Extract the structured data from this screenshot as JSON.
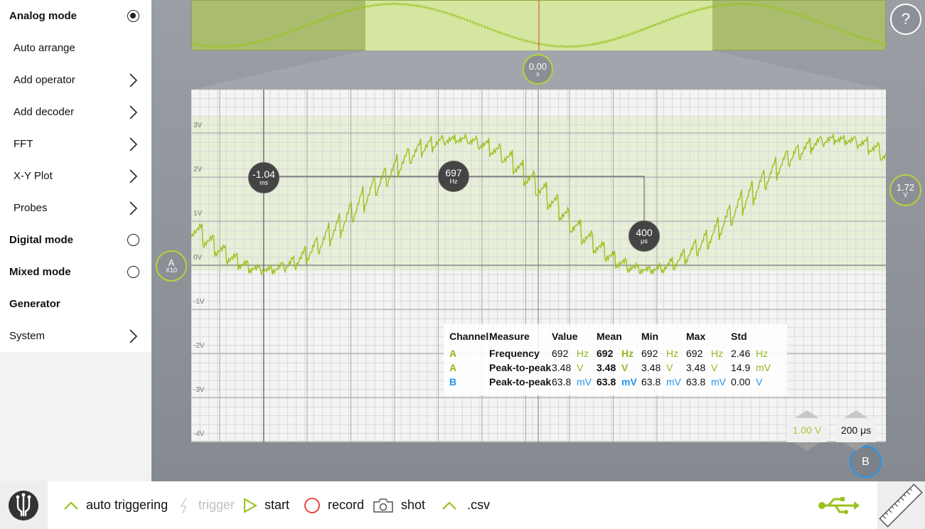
{
  "sidebar": {
    "items": [
      {
        "label": "Analog mode",
        "kind": "radio",
        "selected": true
      },
      {
        "label": "Auto arrange",
        "kind": "action"
      },
      {
        "label": "Add operator",
        "kind": "submenu"
      },
      {
        "label": "Add decoder",
        "kind": "submenu"
      },
      {
        "label": "FFT",
        "kind": "submenu"
      },
      {
        "label": "X-Y Plot",
        "kind": "submenu"
      },
      {
        "label": "Probes",
        "kind": "submenu"
      },
      {
        "label": "Digital mode",
        "kind": "radio",
        "selected": false
      },
      {
        "label": "Mixed mode",
        "kind": "radio",
        "selected": false
      },
      {
        "label": "Generator",
        "kind": "header"
      },
      {
        "label": "System",
        "kind": "submenu"
      }
    ]
  },
  "scope": {
    "help_label": "?",
    "trigger_time": {
      "value": "0.00",
      "unit": "s"
    },
    "trigger_level": {
      "value": "1.72",
      "unit": "V"
    },
    "channel_a": {
      "name": "A",
      "probe": "X10"
    },
    "channel_b": {
      "name": "B"
    },
    "y_ticks": [
      "3V",
      "2V",
      "1V",
      "0V",
      "-1V",
      "-2V",
      "-3V",
      "-4V"
    ],
    "cursor_time": {
      "value": "-1.04",
      "unit": "ms"
    },
    "cursor_freq": {
      "value": "697",
      "unit": "Hz"
    },
    "cursor_period": {
      "value": "400",
      "unit": "μs"
    },
    "volts_div": "1.00 V",
    "time_div": "200 μs"
  },
  "measurements": {
    "headers": [
      "Channel",
      "Measure",
      "Value",
      "Mean",
      "Min",
      "Max",
      "Std"
    ],
    "rows": [
      {
        "channel": "A",
        "measure": "Frequency",
        "value": "692",
        "value_unit": "Hz",
        "mean": "692",
        "mean_unit": "Hz",
        "min": "692",
        "min_unit": "Hz",
        "max": "692",
        "max_unit": "Hz",
        "std": "2.46",
        "std_unit": "Hz"
      },
      {
        "channel": "A",
        "measure": "Peak-to-peak",
        "value": "3.48",
        "value_unit": "V",
        "mean": "3.48",
        "mean_unit": "V",
        "min": "3.48",
        "min_unit": "V",
        "max": "3.48",
        "max_unit": "V",
        "std": "14.9",
        "std_unit": "mV"
      },
      {
        "channel": "B",
        "measure": "Peak-to-peak",
        "value": "63.8",
        "value_unit": "mV",
        "mean": "63.8",
        "mean_unit": "mV",
        "min": "63.8",
        "min_unit": "mV",
        "max": "63.8",
        "max_unit": "mV",
        "std": "0.00",
        "std_unit": "V"
      }
    ]
  },
  "bottombar": {
    "auto_triggering": "auto triggering",
    "trigger": "trigger",
    "start": "start",
    "record": "record",
    "shot": "shot",
    "csv": ".csv"
  },
  "colors": {
    "channel_a": "#8fb81e",
    "channel_b": "#2196f3",
    "trace": "#99c21c"
  },
  "icons": [
    "chevron-right-icon",
    "radio-icon",
    "help-icon",
    "chevron-up-icon",
    "lightning-icon",
    "play-icon",
    "record-icon",
    "camera-icon",
    "usb-icon",
    "ruler-icon",
    "logo-icon"
  ]
}
